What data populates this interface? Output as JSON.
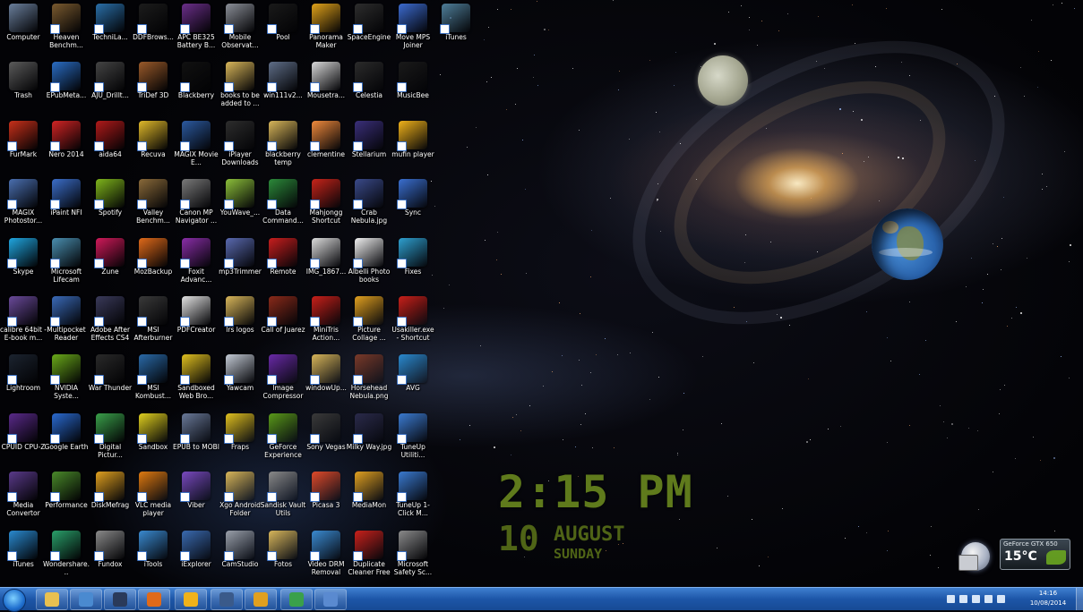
{
  "desktop": {
    "icons": [
      {
        "label": "Computer",
        "icon": "computer-icon",
        "color": "#6a7f9c"
      },
      {
        "label": "Heaven Benchm...",
        "icon": "heaven-benchmark-icon",
        "color": "#7a5a2f"
      },
      {
        "label": "TechniLa...",
        "icon": "technilab-icon",
        "color": "#2a6fa8"
      },
      {
        "label": "DDFBrows...",
        "icon": "ddf-browser-icon",
        "color": "#1c1c1c"
      },
      {
        "label": "APC BE325 Battery B...",
        "icon": "apc-battery-icon",
        "color": "#6b2f8a"
      },
      {
        "label": "Mobile Observat...",
        "icon": "mobile-observatory-icon",
        "color": "#8b8f98"
      },
      {
        "label": "Pool",
        "icon": "pool-icon",
        "color": "#1a1a1a"
      },
      {
        "label": "Panorama Maker",
        "icon": "panorama-maker-icon",
        "color": "#e0a21a"
      },
      {
        "label": "SpaceEngine",
        "icon": "spaceengine-icon",
        "color": "#2d2d2d"
      },
      {
        "label": "Move MPS Joiner",
        "icon": "move-mps-joiner-icon",
        "color": "#3c6bd0"
      },
      {
        "label": "iTunes",
        "icon": "itunes-shortcut-icon",
        "color": "#4f7f9a"
      },
      {
        "label": "Trash",
        "icon": "trash-icon",
        "color": "#5b5b5b"
      },
      {
        "label": "EPubMeta...",
        "icon": "epubmeta-icon",
        "color": "#2a6dc4"
      },
      {
        "label": "AJU_Drillt...",
        "icon": "aju-drill-icon",
        "color": "#444444"
      },
      {
        "label": "TriDef 3D",
        "icon": "tridef-3d-icon",
        "color": "#9a5a2a"
      },
      {
        "label": "Blackberry",
        "icon": "blackberry-icon",
        "color": "#111111"
      },
      {
        "label": "books to be added to ...",
        "icon": "folder-books-icon",
        "color": "#d8b65a"
      },
      {
        "label": "win111v2...",
        "icon": "win111-icon",
        "color": "#5f6e88"
      },
      {
        "label": "Mousetra...",
        "icon": "mousetrap-icon",
        "color": "#d9d9d9"
      },
      {
        "label": "Celestia",
        "icon": "celestia-icon",
        "color": "#2b2b2b"
      },
      {
        "label": "MusicBee",
        "icon": "musicbee-icon",
        "color": "#1a1a1a"
      },
      {
        "label": "FurMark",
        "icon": "furmark-icon",
        "color": "#c8301a"
      },
      {
        "label": "Nero 2014",
        "icon": "nero-icon",
        "color": "#d12424"
      },
      {
        "label": "aida64",
        "icon": "aida64-icon",
        "color": "#b01a1a"
      },
      {
        "label": "Recuva",
        "icon": "recuva-icon",
        "color": "#e0b92a"
      },
      {
        "label": "MAGIX Movie E...",
        "icon": "magix-movie-icon",
        "color": "#2c5aa0"
      },
      {
        "label": "iPlayer Downloads",
        "icon": "iplayer-icon",
        "color": "#2d2d2d"
      },
      {
        "label": "blackberry temp",
        "icon": "folder-blackberry-icon",
        "color": "#d8b65a"
      },
      {
        "label": "clementine",
        "icon": "clementine-icon",
        "color": "#f08a3c"
      },
      {
        "label": "Stellarium",
        "icon": "stellarium-icon",
        "color": "#3a2f7a"
      },
      {
        "label": "mufin player",
        "icon": "mufin-player-icon",
        "color": "#f0b21a"
      },
      {
        "label": "MAGIX Photostor...",
        "icon": "magix-photostory-icon",
        "color": "#4a6fb0"
      },
      {
        "label": "iPaint NFI",
        "icon": "ipaint-icon",
        "color": "#3b6ec9"
      },
      {
        "label": "Spotify",
        "icon": "spotify-icon",
        "color": "#7fb51c"
      },
      {
        "label": "Valley Benchm...",
        "icon": "valley-benchmark-icon",
        "color": "#8a6a3a"
      },
      {
        "label": "Canon MP Navigator ...",
        "icon": "canon-navigator-icon",
        "color": "#7a7a7a"
      },
      {
        "label": "YouWave_...",
        "icon": "youwave-icon",
        "color": "#8cbf3a"
      },
      {
        "label": "Data Command...",
        "icon": "data-command-icon",
        "color": "#2c8a3a"
      },
      {
        "label": "Mahjongg Shortcut",
        "icon": "mahjongg-icon",
        "color": "#c7241a"
      },
      {
        "label": "Crab Nebula.jpg",
        "icon": "crab-nebula-icon",
        "color": "#3a4a8a"
      },
      {
        "label": "Sync",
        "icon": "sync-icon",
        "color": "#3a6fd0"
      },
      {
        "label": "Skype",
        "icon": "skype-icon",
        "color": "#20a6e0"
      },
      {
        "label": "Microsoft Lifecam",
        "icon": "lifecam-icon",
        "color": "#4a8fb0"
      },
      {
        "label": "Zune",
        "icon": "zune-icon",
        "color": "#d01a5a"
      },
      {
        "label": "MozBackup",
        "icon": "mozbackup-icon",
        "color": "#e06a1a"
      },
      {
        "label": "Foxit Advanc...",
        "icon": "foxit-icon",
        "color": "#8a2ea8"
      },
      {
        "label": "mp3Trimmer",
        "icon": "mp3trimmer-icon",
        "color": "#5a6ab0"
      },
      {
        "label": "Remote",
        "icon": "remote-icon",
        "color": "#c81e1e"
      },
      {
        "label": "IMG_1867...",
        "icon": "image-file-icon",
        "color": "#dcdcdc"
      },
      {
        "label": "Albelli Photo books",
        "icon": "albelli-icon",
        "color": "#f0f0f0"
      },
      {
        "label": "Fixes",
        "icon": "fixes-icon",
        "color": "#2ea0d0"
      },
      {
        "label": "calibre 64bit - E-book m...",
        "icon": "calibre-icon",
        "color": "#6a4a9a"
      },
      {
        "label": "Multipocket Reader",
        "icon": "multipocket-icon",
        "color": "#3a6ab8"
      },
      {
        "label": "Adobe After Effects CS4",
        "icon": "after-effects-icon",
        "color": "#3a3a5a"
      },
      {
        "label": "MSI Afterburner",
        "icon": "msi-afterburner-icon",
        "color": "#3a3a3a"
      },
      {
        "label": "PDFCreator",
        "icon": "pdfcreator-icon",
        "color": "#e2e2e2"
      },
      {
        "label": "lrs logos",
        "icon": "folder-logos-icon",
        "color": "#d8b65a"
      },
      {
        "label": "Call of Juarez",
        "icon": "call-of-juarez-icon",
        "color": "#8a2a1a"
      },
      {
        "label": "MiniTris Action...",
        "icon": "minitris-icon",
        "color": "#c8201a"
      },
      {
        "label": "Picture Collage ...",
        "icon": "picture-collage-icon",
        "color": "#e0a020"
      },
      {
        "label": "Usakiller.exe - Shortcut",
        "icon": "usakiller-icon",
        "color": "#c8201a"
      },
      {
        "label": "Lightroom",
        "icon": "lightroom-icon",
        "color": "#1c2430"
      },
      {
        "label": "NVIDIA Syste...",
        "icon": "nvidia-system-icon",
        "color": "#6aaa1a"
      },
      {
        "label": "War Thunder",
        "icon": "war-thunder-icon",
        "color": "#2a2a2a"
      },
      {
        "label": "MSI Kombust...",
        "icon": "msi-kombustor-icon",
        "color": "#2a6aa8"
      },
      {
        "label": "Sandboxed Web Bro...",
        "icon": "sandboxed-browser-icon",
        "color": "#e0c020"
      },
      {
        "label": "Yawcam",
        "icon": "yawcam-icon",
        "color": "#c4cbd6"
      },
      {
        "label": "Image Compressor",
        "icon": "image-compressor-icon",
        "color": "#6a2aa8"
      },
      {
        "label": "windowUp...",
        "icon": "folder-windowup-icon",
        "color": "#d8b65a"
      },
      {
        "label": "Horsehead Nebula.png",
        "icon": "horsehead-nebula-icon",
        "color": "#7a3a2a"
      },
      {
        "label": "AVG",
        "icon": "avg-icon",
        "color": "#2a8ad0"
      },
      {
        "label": "CPUID CPU-Z",
        "icon": "cpuz-icon",
        "color": "#5a2a8a"
      },
      {
        "label": "Google Earth",
        "icon": "google-earth-icon",
        "color": "#2a6ad0"
      },
      {
        "label": "Digital Pictur...",
        "icon": "digital-picture-icon",
        "color": "#3aa04a"
      },
      {
        "label": "Sandbox",
        "icon": "sandbox-icon",
        "color": "#e0d020"
      },
      {
        "label": "EPUB to MOBI",
        "icon": "epub-mobi-icon",
        "color": "#6a7a9a"
      },
      {
        "label": "Fraps",
        "icon": "fraps-icon",
        "color": "#e0c020"
      },
      {
        "label": "GeForce Experience",
        "icon": "geforce-experience-icon",
        "color": "#5a9a1a"
      },
      {
        "label": "Sony Vegas",
        "icon": "sony-vegas-icon",
        "color": "#3a3a3a"
      },
      {
        "label": "Milky Way.jpg",
        "icon": "milky-way-icon",
        "color": "#2a2a4a"
      },
      {
        "label": "TuneUp Utiliti...",
        "icon": "tuneup-icon",
        "color": "#3a7ad0"
      },
      {
        "label": "Media Convertor",
        "icon": "media-convertor-icon",
        "color": "#5a3a8a"
      },
      {
        "label": "Performance",
        "icon": "performance-icon",
        "color": "#4a8a2a"
      },
      {
        "label": "DiskMefrag",
        "icon": "diskdefrag-icon",
        "color": "#e0a020"
      },
      {
        "label": "VLC media player",
        "icon": "vlc-icon",
        "color": "#e07a10"
      },
      {
        "label": "Viber",
        "icon": "viber-icon",
        "color": "#7a4ac0"
      },
      {
        "label": "Xgo Android Folder",
        "icon": "folder-android-icon",
        "color": "#d8b65a"
      },
      {
        "label": "Sandisk Vault Utils",
        "icon": "sandisk-vault-icon",
        "color": "#8a8a8a"
      },
      {
        "label": "Picasa 3",
        "icon": "picasa-icon",
        "color": "#e04a2a"
      },
      {
        "label": "MediaMon",
        "icon": "mediamon-icon",
        "color": "#e0a020"
      },
      {
        "label": "TuneUp 1-Click M...",
        "icon": "tuneup-oneclick-icon",
        "color": "#3a7ad0"
      },
      {
        "label": "iTunes",
        "icon": "itunes-icon",
        "color": "#2a8ad0"
      },
      {
        "label": "Wondershare...",
        "icon": "wondershare-icon",
        "color": "#2aa06a"
      },
      {
        "label": "Fundox",
        "icon": "fundox-icon",
        "color": "#8a8a8a"
      },
      {
        "label": "iTools",
        "icon": "itools-icon",
        "color": "#3a8ad0"
      },
      {
        "label": "iExplorer",
        "icon": "iexplorer-icon",
        "color": "#3a6ab0"
      },
      {
        "label": "CamStudio",
        "icon": "camstudio-icon",
        "color": "#9aa0aa"
      },
      {
        "label": "Fotos",
        "icon": "folder-fotos-icon",
        "color": "#d8b65a"
      },
      {
        "label": "Video DRM Removal",
        "icon": "video-drm-icon",
        "color": "#3a8ad0"
      },
      {
        "label": "Duplicate Cleaner Free",
        "icon": "duplicate-cleaner-icon",
        "color": "#c8201a"
      },
      {
        "label": "Microsoft Safety Sc...",
        "icon": "safety-scanner-icon",
        "color": "#8a8a8a"
      }
    ]
  },
  "clock": {
    "time": "2:15 PM",
    "day": "10",
    "month": "AUGUST",
    "weekday": "SUNDAY"
  },
  "gpu_gadget": {
    "name": "GeForce GTX 650",
    "temperature": "15°C"
  },
  "taskbar": {
    "pinned": [
      {
        "icon": "explorer-icon",
        "color": "#e8c050"
      },
      {
        "icon": "magnifier-icon",
        "color": "#4a8ad0"
      },
      {
        "icon": "steam-icon",
        "color": "#2a3a5a"
      },
      {
        "icon": "firefox-icon",
        "color": "#e06a1a"
      },
      {
        "icon": "mufin-taskbar-icon",
        "color": "#f0b21a"
      },
      {
        "icon": "winamp-icon",
        "color": "#3a5a8a"
      },
      {
        "icon": "puzzle-icon",
        "color": "#e0a020"
      },
      {
        "icon": "digital-picture-taskbar-icon",
        "color": "#3aa04a"
      },
      {
        "icon": "paint-icon",
        "color": "#5a8ad0"
      }
    ],
    "tray_time": "14:16",
    "tray_date": "10/08/2014"
  }
}
